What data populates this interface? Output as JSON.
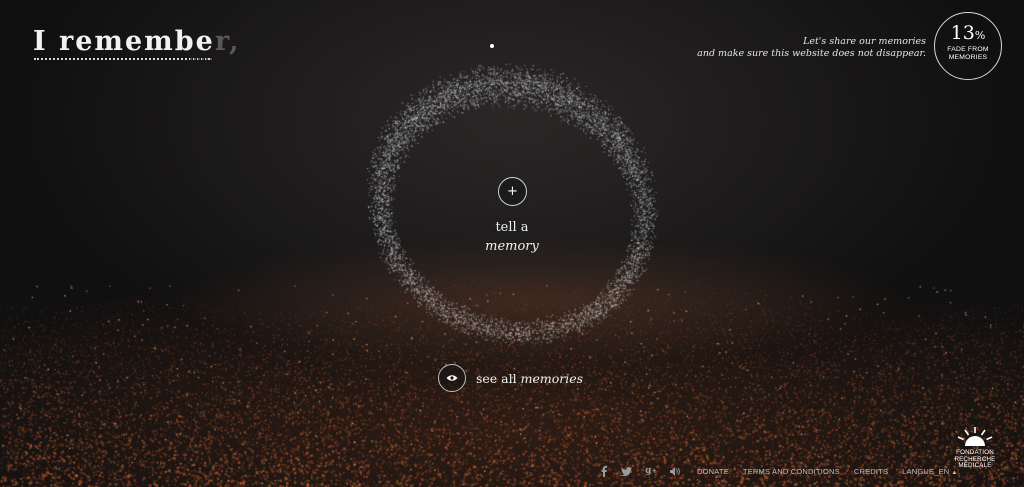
{
  "header": {
    "logo_main": "I remembe",
    "logo_faded": "r,",
    "share_line1": "Let's share our memories",
    "share_line2": "and make sure this website does not disappear.",
    "fade_percent": "13",
    "fade_percent_sign": "%",
    "fade_label_line1": "FADE FROM",
    "fade_label_line2": "MEMORIES"
  },
  "center": {
    "add_icon": "plus-icon",
    "tell_line1": "tell a",
    "tell_line2": "memory",
    "see_all_prefix": "see all",
    "see_all_italic": "memories",
    "see_all_icon": "eye-icon"
  },
  "footer": {
    "social_icons": [
      "facebook-icon",
      "twitter-icon",
      "google-plus-icon",
      "sound-icon"
    ],
    "donate": "DONATE",
    "terms": "TERMS AND CONDITIONS",
    "credits": "CREDITS",
    "language": "LANGUE_EN"
  },
  "partner": {
    "line1": "FONDATION",
    "line2": "RECHERCHE",
    "line3": "MÉDICALE"
  },
  "colors": {
    "background": "#0d0c0c",
    "particle_ring": "#cfcfcf",
    "particle_ground": "#c07a4a",
    "text": "#ffffff"
  }
}
